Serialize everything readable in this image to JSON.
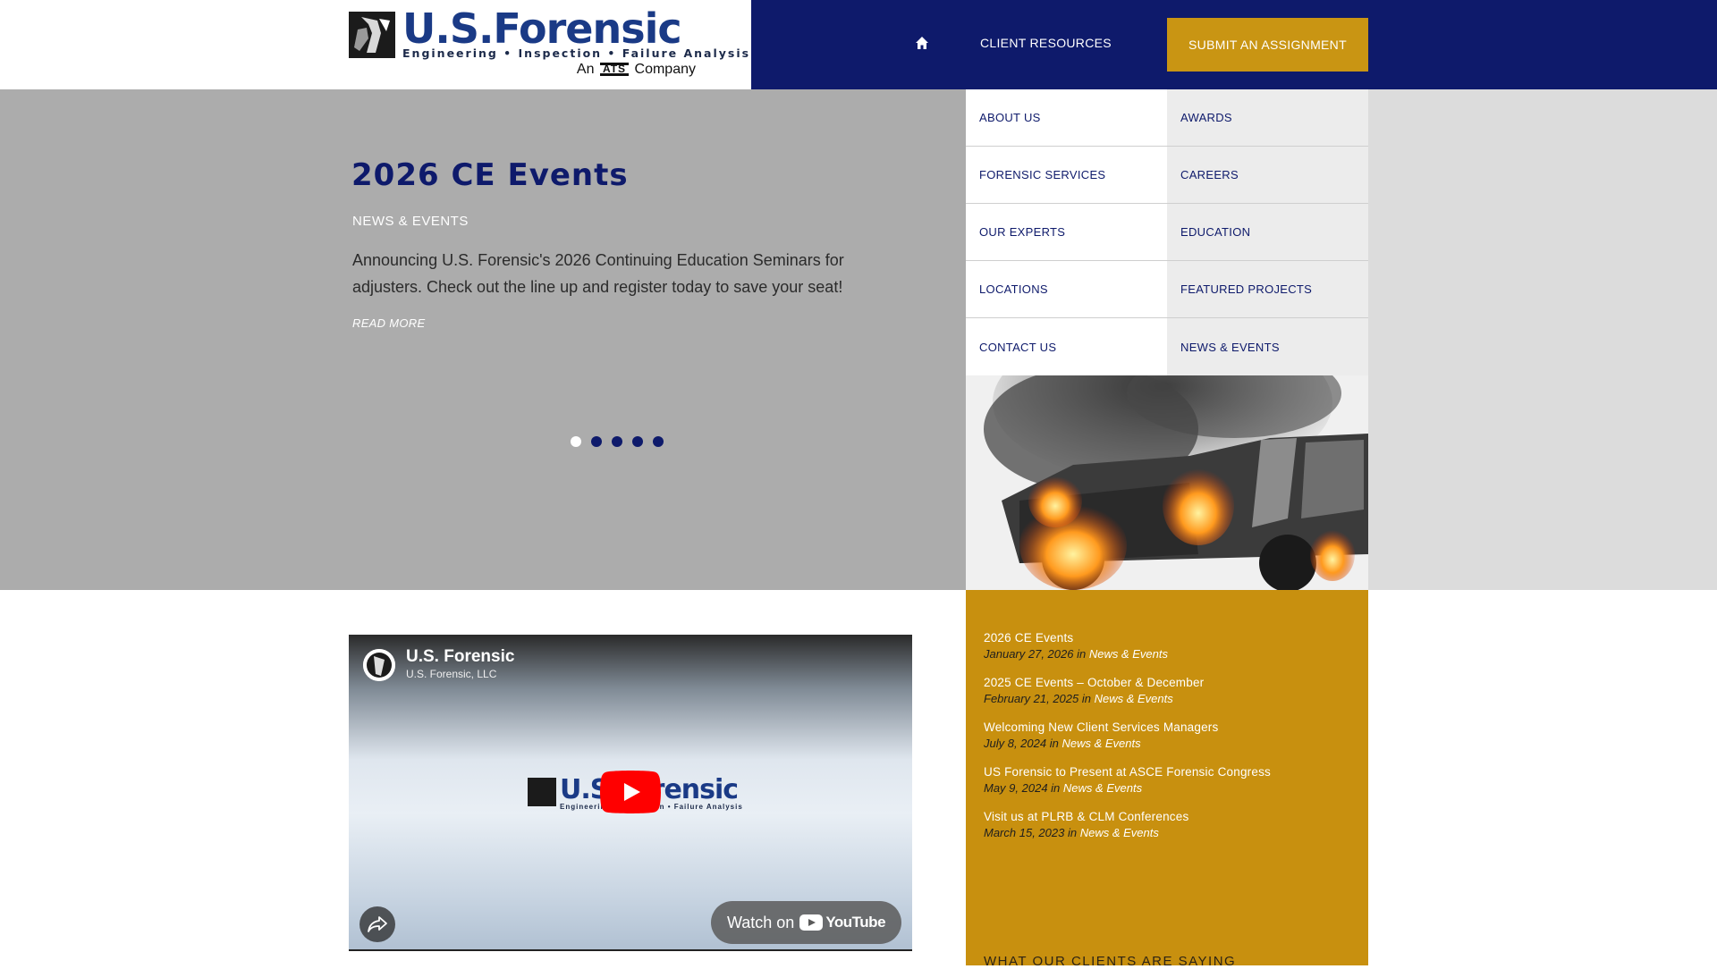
{
  "header": {
    "logo": {
      "name": "U.S.Forensic",
      "tagline": "Engineering • Inspection • Failure Analysis",
      "sub_prefix": "An",
      "sub_mark": "ATS",
      "sub_suffix": "Company"
    },
    "nav": {
      "home_icon": "home-icon",
      "client_resources": "CLIENT RESOURCES",
      "submit_assignment": "SUBMIT AN ASSIGNMENT"
    },
    "colors": {
      "navy": "#0e1a6b",
      "gold": "#c99513"
    }
  },
  "hero": {
    "title": "2026 CE Events",
    "category": "NEWS & EVENTS",
    "description": "Announcing U.S. Forensic's 2026 Continuing Education Seminars for adjusters. Check out the line up and register today to save your seat!",
    "read_more": "READ MORE",
    "slides_total": 5,
    "active_slide": 1
  },
  "menu": {
    "items": [
      "ABOUT US",
      "AWARDS",
      "FORENSIC SERVICES",
      "CAREERS",
      "OUR EXPERTS",
      "EDUCATION",
      "LOCATIONS",
      "FEATURED PROJECTS",
      "CONTACT US",
      "NEWS & EVENTS"
    ]
  },
  "video": {
    "channel_name": "U.S. Forensic",
    "channel_sub": "U.S. Forensic, LLC",
    "logo_name": "U.S.Forensic",
    "logo_tagline": "Engineering • Inspection • Failure Analysis",
    "watch_on": "Watch on",
    "youtube": "YouTube"
  },
  "news": {
    "items": [
      {
        "title": "2026 CE Events",
        "date": "January 27, 2026",
        "in": "in",
        "category": "News & Events"
      },
      {
        "title": "2025 CE Events – October & December",
        "date": "February 21, 2025",
        "in": "in",
        "category": "News & Events"
      },
      {
        "title": "Welcoming New Client Services Managers",
        "date": "July 8, 2024",
        "in": "in",
        "category": "News & Events"
      },
      {
        "title": "US Forensic to Present at ASCE Forensic Congress",
        "date": "May 9, 2024",
        "in": "in",
        "category": "News & Events"
      },
      {
        "title": "Visit us at PLRB & CLM Conferences",
        "date": "March 15, 2023",
        "in": "in",
        "category": "News & Events"
      }
    ],
    "clients_heading": "WHAT OUR CLIENTS ARE SAYING"
  }
}
